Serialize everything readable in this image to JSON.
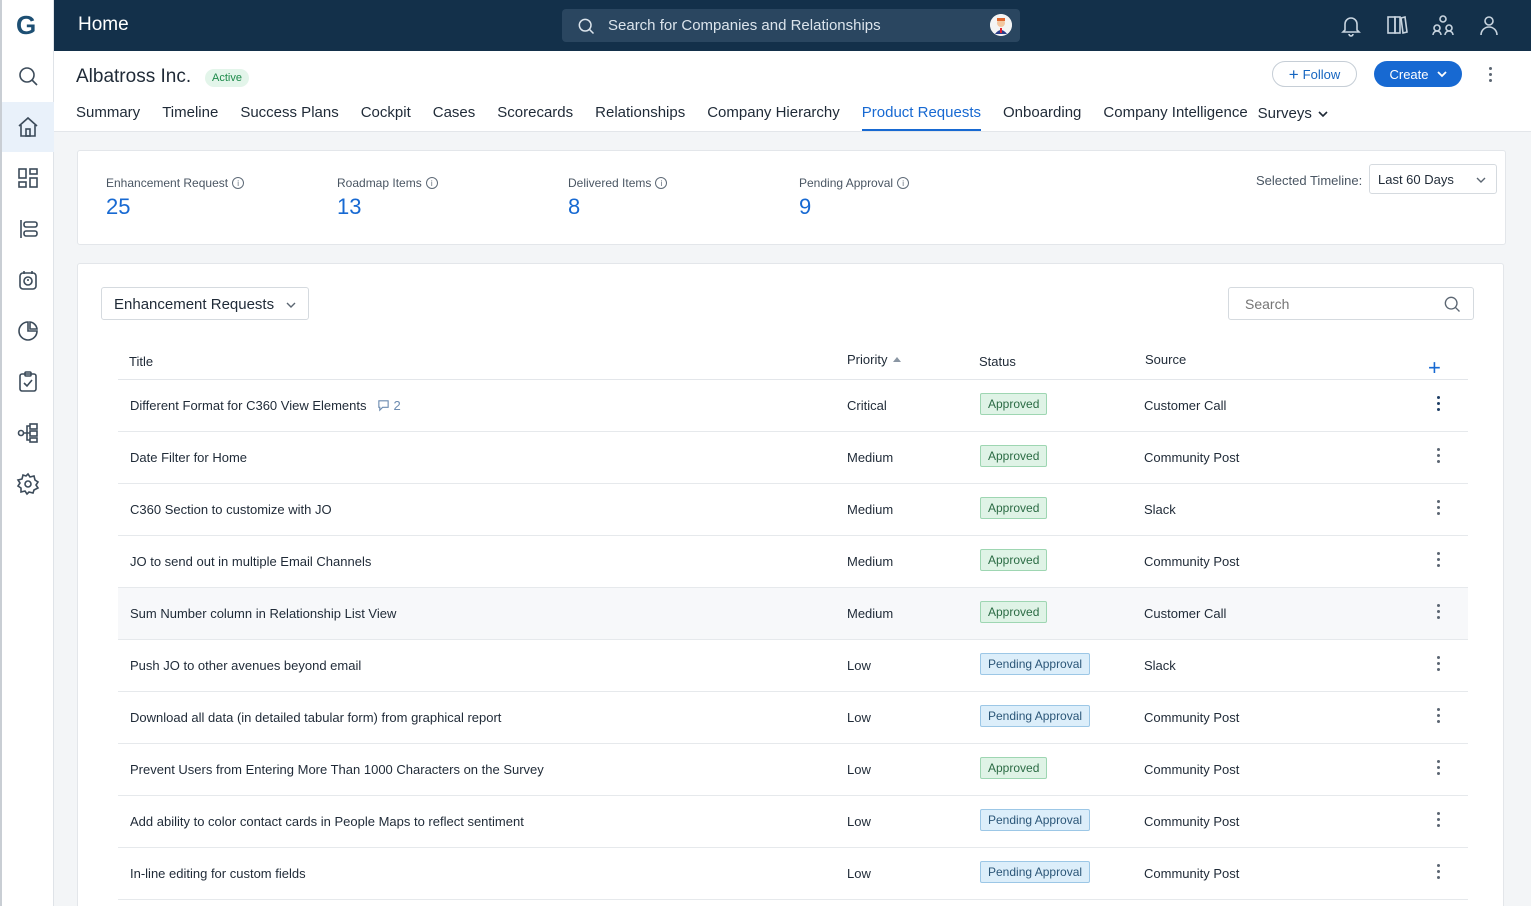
{
  "app": {
    "logo_letter": "G"
  },
  "topbar": {
    "title": "Home",
    "search_placeholder": "Search for Companies and Relationships"
  },
  "company": {
    "name": "Albatross Inc.",
    "status": "Active",
    "follow_label": "Follow",
    "create_label": "Create"
  },
  "tabs": [
    {
      "label": "Summary"
    },
    {
      "label": "Timeline"
    },
    {
      "label": "Success Plans"
    },
    {
      "label": "Cockpit"
    },
    {
      "label": "Cases"
    },
    {
      "label": "Scorecards"
    },
    {
      "label": "Relationships"
    },
    {
      "label": "Company Hierarchy"
    },
    {
      "label": "Product Requests",
      "active": true
    },
    {
      "label": "Onboarding"
    },
    {
      "label": "Company Intelligence"
    },
    {
      "label": "Surveys"
    }
  ],
  "stats": [
    {
      "label": "Enhancement Request",
      "value": "25"
    },
    {
      "label": "Roadmap Items",
      "value": "13"
    },
    {
      "label": "Delivered Items",
      "value": "8"
    },
    {
      "label": "Pending Approval",
      "value": "9"
    }
  ],
  "timeline": {
    "label": "Selected Timeline:",
    "value": "Last 60 Days"
  },
  "table": {
    "view": "Enhancement Requests",
    "search_placeholder": "Search",
    "columns": {
      "title": "Title",
      "priority": "Priority",
      "status": "Status",
      "source": "Source"
    },
    "rows": [
      {
        "title": "Different Format for C360 View Elements",
        "comments": "2",
        "priority": "Critical",
        "status": "Approved",
        "source": "Customer Call"
      },
      {
        "title": "Date Filter for Home",
        "priority": "Medium",
        "status": "Approved",
        "source": "Community Post"
      },
      {
        "title": "C360 Section to customize with JO",
        "priority": "Medium",
        "status": "Approved",
        "source": "Slack"
      },
      {
        "title": "JO to send out in multiple Email Channels",
        "priority": "Medium",
        "status": "Approved",
        "source": "Community Post"
      },
      {
        "title": "Sum Number column in Relationship List View",
        "priority": "Medium",
        "status": "Approved",
        "source": "Customer Call"
      },
      {
        "title": "Push JO to other avenues beyond email",
        "priority": "Low",
        "status": "Pending Approval",
        "source": "Slack"
      },
      {
        "title": "Download all data (in detailed tabular form) from graphical report",
        "priority": "Low",
        "status": "Pending Approval",
        "source": "Community Post"
      },
      {
        "title": "Prevent Users from Entering More Than 1000 Characters on the Survey",
        "priority": "Low",
        "status": "Approved",
        "source": "Community Post"
      },
      {
        "title": "Add ability to color contact cards in People Maps to reflect sentiment",
        "priority": "Low",
        "status": "Pending Approval",
        "source": "Community Post"
      },
      {
        "title": "In-line editing for custom fields",
        "priority": "Low",
        "status": "Pending Approval",
        "source": "Community Post"
      }
    ]
  },
  "colors": {
    "topbar": "#13304a",
    "accent": "#1769d2",
    "approved": "#dff3e6",
    "pending": "#dceefa"
  }
}
